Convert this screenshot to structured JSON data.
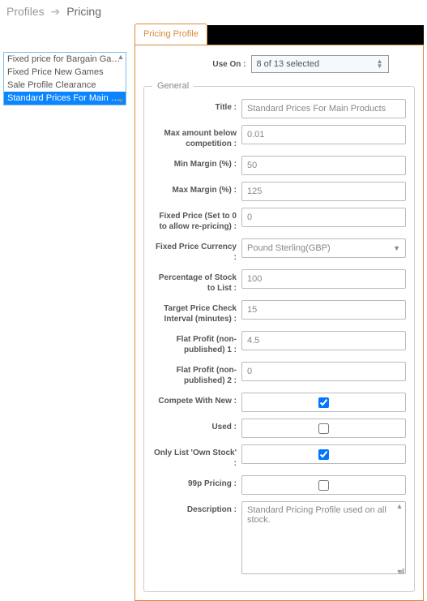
{
  "breadcrumb": {
    "parent": "Profiles",
    "current": "Pricing"
  },
  "sidebar": {
    "items": [
      {
        "label": "Fixed price for Bargain Games"
      },
      {
        "label": "Fixed Price New Games"
      },
      {
        "label": "Sale Profile Clearance"
      },
      {
        "label": "Standard Prices For Main Products"
      }
    ],
    "selected_index": 3
  },
  "tabs": {
    "active": "Pricing Profile"
  },
  "use_on": {
    "label": "Use On :",
    "value": "8 of 13 selected"
  },
  "general": {
    "legend": "General",
    "fields": {
      "title": {
        "label": "Title :",
        "value": "Standard Prices For Main Products"
      },
      "max_below_comp": {
        "label": "Max amount below competition :",
        "value": "0.01"
      },
      "min_margin": {
        "label": "Min Margin (%) :",
        "value": "50"
      },
      "max_margin": {
        "label": "Max Margin (%) :",
        "value": "125"
      },
      "fixed_price": {
        "label": "Fixed Price (Set to 0 to allow re-pricing) :",
        "value": "0"
      },
      "fixed_currency": {
        "label": "Fixed Price Currency :",
        "value": "Pound Sterling(GBP)"
      },
      "pct_stock_list": {
        "label": "Percentage of Stock to List :",
        "value": "100"
      },
      "price_check_int": {
        "label": "Target Price Check Interval (minutes) :",
        "value": "15"
      },
      "flat_profit_1": {
        "label": "Flat Profit (non-published) 1 :",
        "value": "4.5"
      },
      "flat_profit_2": {
        "label": "Flat Profit (non-published) 2 :",
        "value": "0"
      },
      "compete_new": {
        "label": "Compete With New :",
        "checked": true
      },
      "used": {
        "label": "Used :",
        "checked": false
      },
      "only_own_stock": {
        "label": "Only List 'Own Stock' :",
        "checked": true
      },
      "pricing_99p": {
        "label": "99p Pricing :",
        "checked": false
      },
      "description": {
        "label": "Description :",
        "value": "Standard Pricing Profile used on all stock."
      }
    }
  }
}
